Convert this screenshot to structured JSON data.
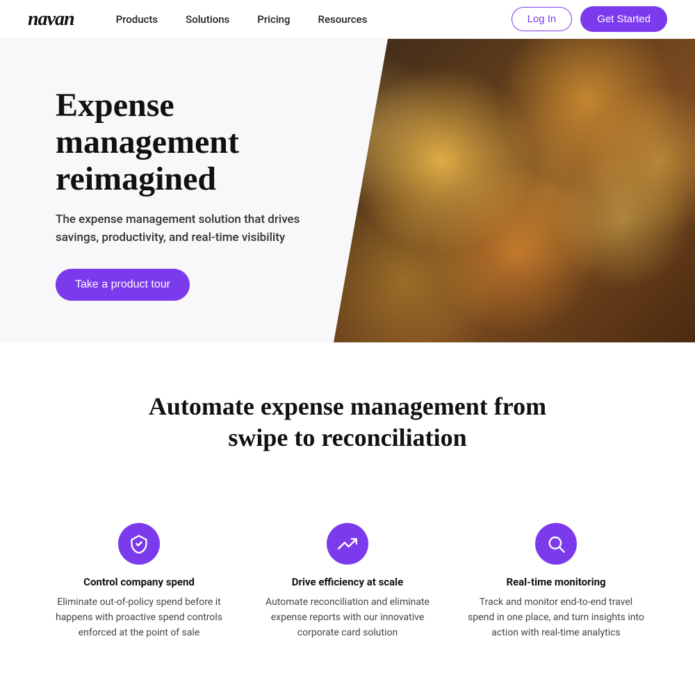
{
  "brand": {
    "logo": "navan"
  },
  "nav": {
    "links": [
      {
        "label": "Products",
        "id": "products"
      },
      {
        "label": "Solutions",
        "id": "solutions"
      },
      {
        "label": "Pricing",
        "id": "pricing"
      },
      {
        "label": "Resources",
        "id": "resources"
      }
    ],
    "login_label": "Log In",
    "get_started_label": "Get Started"
  },
  "hero": {
    "title": "Expense management reimagined",
    "subtitle": "The expense management solution that drives savings, productivity, and real-time visibility",
    "cta_label": "Take a product tour"
  },
  "section2": {
    "title": "Automate expense management from swipe to reconciliation"
  },
  "features": [
    {
      "id": "control",
      "icon": "shield",
      "title": "Control company spend",
      "description": "Eliminate out-of-policy spend before it happens with proactive spend controls enforced at the point of sale"
    },
    {
      "id": "efficiency",
      "icon": "trending-up",
      "title": "Drive efficiency at scale",
      "description": "Automate reconciliation and eliminate expense reports with our innovative corporate card solution"
    },
    {
      "id": "monitoring",
      "icon": "search",
      "title": "Real-time monitoring",
      "description": "Track and monitor end-to-end travel spend in one place, and turn insights into action with real-time analytics"
    }
  ]
}
